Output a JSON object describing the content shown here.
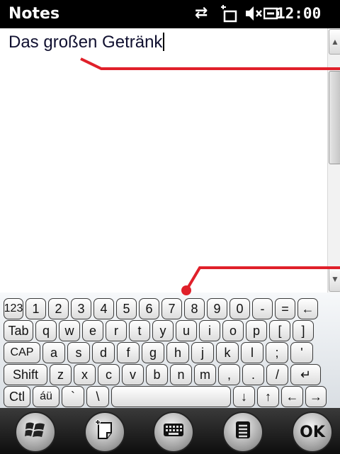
{
  "statusbar": {
    "app_title": "Notes",
    "time": "12:00",
    "icons": [
      "network-sync-icon",
      "no-signal-icon",
      "speaker-muted-icon",
      "battery-charging-icon"
    ]
  },
  "editor": {
    "text": "Das großen Getränk"
  },
  "keyboard": {
    "rows": [
      [
        "123",
        "1",
        "2",
        "3",
        "4",
        "5",
        "6",
        "7",
        "8",
        "9",
        "0",
        "-",
        "=",
        "←"
      ],
      [
        "Tab",
        "q",
        "w",
        "e",
        "r",
        "t",
        "y",
        "u",
        "i",
        "o",
        "p",
        "[",
        "]"
      ],
      [
        "CAP",
        "a",
        "s",
        "d",
        "f",
        "g",
        "h",
        "j",
        "k",
        "l",
        ";",
        "'"
      ],
      [
        "Shift",
        "z",
        "x",
        "c",
        "v",
        "b",
        "n",
        "m",
        ",",
        ".",
        "/",
        "↵"
      ],
      [
        "Ctl",
        "áü",
        "`",
        "\\",
        " ",
        "↓",
        "↑",
        "←",
        "→"
      ]
    ]
  },
  "taskbar": {
    "start_icon": "windows-start-icon",
    "new_note_icon": "new-note-icon",
    "keyboard_icon": "keyboard-icon",
    "menu_icon": "menu-icon",
    "ok_label": "OK"
  },
  "annotation_color": "#e0202a"
}
